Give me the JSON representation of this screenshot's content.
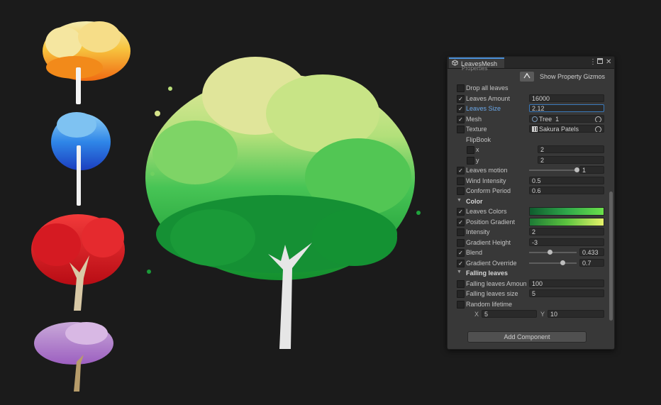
{
  "colors": {
    "background": "#1b1b1b",
    "panel": "#383838",
    "tab_accent": "#4a90d9",
    "focus_blue": "#3a79bb"
  },
  "scene": {
    "description_icons": [
      "yellow-orange-tree",
      "blue-tree",
      "red-tree",
      "purple-tree",
      "green-tree-large"
    ]
  },
  "inspector": {
    "tab_title": "LeavesMesh",
    "cut_label": "Properties",
    "show_gizmos_label": "Show Property Gizmos",
    "add_component": "Add Component",
    "rows": [
      {
        "name": "drop-all-leaves",
        "label": "Drop all leaves",
        "checked": false,
        "kind": "toggle"
      },
      {
        "name": "leaves-amount",
        "label": "Leaves Amount",
        "checked": true,
        "kind": "field",
        "value": "16000"
      },
      {
        "name": "leaves-size",
        "label": "Leaves Size",
        "checked": true,
        "kind": "field",
        "value": "2.12",
        "focused": true
      },
      {
        "name": "mesh",
        "label": "Mesh",
        "checked": true,
        "kind": "object",
        "value": "Tree_1",
        "icon": "mesh-icon"
      },
      {
        "name": "texture",
        "label": "Texture",
        "checked": false,
        "kind": "object",
        "value": "Sakura Patels",
        "icon": "texture-icon"
      },
      {
        "name": "flipbook",
        "label": "FlipBook",
        "kind": "header-plain"
      },
      {
        "name": "flipbook-x",
        "label": "x",
        "checked": false,
        "kind": "short",
        "value": "2"
      },
      {
        "name": "flipbook-y",
        "label": "y",
        "checked": false,
        "kind": "short",
        "value": "2"
      },
      {
        "name": "leaves-motion",
        "label": "Leaves motion",
        "checked": true,
        "kind": "slider",
        "value": "1",
        "level": 1.0
      },
      {
        "name": "wind-intensity",
        "label": "Wind Intensity",
        "checked": false,
        "kind": "field",
        "value": "0.5"
      },
      {
        "name": "conform-period",
        "label": "Conform Period",
        "checked": false,
        "kind": "field",
        "value": "0.6"
      },
      {
        "name": "color-section",
        "label": "Color",
        "kind": "section"
      },
      {
        "name": "leaves-colors",
        "label": "Leaves Colors",
        "checked": true,
        "kind": "gradient",
        "gradient": [
          "#0f5c2e",
          "#2fa84a",
          "#6be04a"
        ]
      },
      {
        "name": "position-gradient",
        "label": "Position Gradient",
        "checked": true,
        "kind": "gradient",
        "gradient": [
          "#1d7a36",
          "#5cc43f",
          "#e6f26a"
        ]
      },
      {
        "name": "intensity",
        "label": "Intensity",
        "checked": false,
        "kind": "field",
        "value": "2"
      },
      {
        "name": "gradient-height",
        "label": "Gradient Height",
        "checked": false,
        "kind": "field",
        "value": "-3"
      },
      {
        "name": "blend",
        "label": "Blend",
        "checked": true,
        "kind": "slider",
        "value": "0.433",
        "level": 0.433
      },
      {
        "name": "gradient-override",
        "label": "Gradient Override",
        "checked": true,
        "kind": "slider",
        "value": "0.7",
        "level": 0.7
      },
      {
        "name": "falling-leaves-section",
        "label": "Falling leaves",
        "kind": "section"
      },
      {
        "name": "falling-leaves-amount",
        "label": "Falling leaves Amoun",
        "checked": false,
        "kind": "field",
        "value": "100"
      },
      {
        "name": "falling-leaves-size",
        "label": "Falling leaves size",
        "checked": false,
        "kind": "field",
        "value": "5"
      },
      {
        "name": "random-lifetime",
        "label": "Random lifetime",
        "checked": false,
        "kind": "toggle"
      },
      {
        "name": "lifetime-xy",
        "kind": "xy",
        "x_label": "X",
        "x_value": "5",
        "y_label": "Y",
        "y_value": "10"
      }
    ]
  }
}
